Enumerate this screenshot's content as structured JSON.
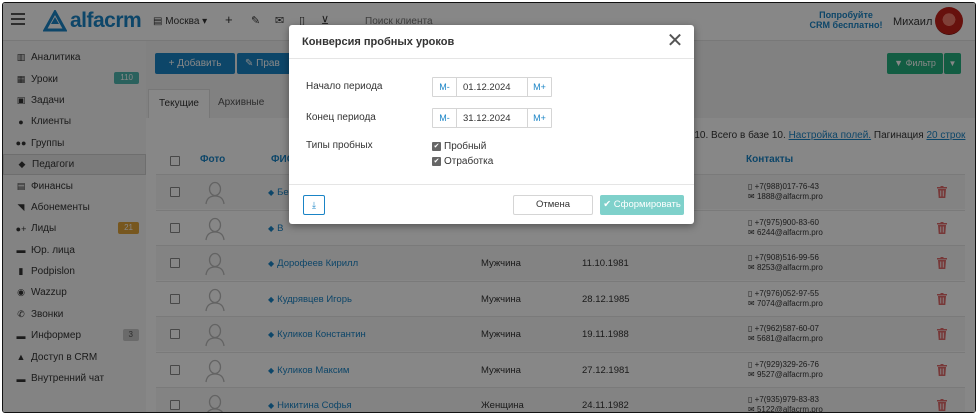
{
  "header": {
    "logo_text": "alfacrm",
    "branch": "Москва",
    "search_placeholder": "Поиск клиента",
    "promo_line1": "Попробуйте",
    "promo_line2": "CRM бесплатно!",
    "user_name": "Михаил"
  },
  "sidebar": {
    "items": [
      {
        "label": "Аналитика",
        "icon": "chart-icon"
      },
      {
        "label": "Уроки",
        "icon": "calendar-icon",
        "badge": "110",
        "badge_color": "#50b7b0"
      },
      {
        "label": "Задачи",
        "icon": "tasks-icon"
      },
      {
        "label": "Клиенты",
        "icon": "user-icon"
      },
      {
        "label": "Группы",
        "icon": "group-icon"
      },
      {
        "label": "Педагоги",
        "icon": "teacher-icon",
        "active": true
      },
      {
        "label": "Финансы",
        "icon": "money-icon"
      },
      {
        "label": "Абонементы",
        "icon": "tag-icon"
      },
      {
        "label": "Лиды",
        "icon": "lead-icon",
        "badge": "21",
        "badge_color": "#e0a43b"
      },
      {
        "label": "Юр. лица",
        "icon": "briefcase-icon"
      },
      {
        "label": "Podpislon",
        "icon": "doc-icon"
      },
      {
        "label": "Wazzup",
        "icon": "chat-icon"
      },
      {
        "label": "Звонки",
        "icon": "phone-icon"
      },
      {
        "label": "Информер",
        "icon": "informer-icon",
        "badge": "3",
        "badge_color": "#c9c9c9"
      },
      {
        "label": "Доступ в CRM",
        "icon": "lock-icon"
      },
      {
        "label": "Внутренний чат",
        "icon": "message-icon"
      }
    ]
  },
  "toolbar": {
    "add_label": "+ Добавить",
    "edit_label": "Прав",
    "filter_label": "Фильтр"
  },
  "tabs": [
    {
      "label": "Текущие",
      "active": true
    },
    {
      "label": "Архивные",
      "active": false
    }
  ],
  "pagination": {
    "text": "– 10. Всего в базе 10.",
    "settings_link": "Настройка полей.",
    "pagination_label": "Пагинация",
    "per_page_link": "20 строк"
  },
  "table": {
    "headers": {
      "photo": "Фото",
      "fio": "ФИО",
      "contacts": "Контакты"
    },
    "rows": [
      {
        "name": "Бе",
        "gender": "",
        "dob": "",
        "phone": "+7(988)017-76-43",
        "email": "1888@alfacrm.pro"
      },
      {
        "name": "В",
        "gender": "",
        "dob": "",
        "phone": "+7(975)900-83-60",
        "email": "6244@alfacrm.pro"
      },
      {
        "name": "Дорофеев Кирилл",
        "gender": "Мужчина",
        "dob": "11.10.1981",
        "phone": "+7(908)516-99-56",
        "email": "8253@alfacrm.pro"
      },
      {
        "name": "Кудрявцев Игорь",
        "gender": "Мужчина",
        "dob": "28.12.1985",
        "phone": "+7(976)052-97-55",
        "email": "7074@alfacrm.pro"
      },
      {
        "name": "Куликов Константин",
        "gender": "Мужчина",
        "dob": "19.11.1988",
        "phone": "+7(962)587-60-07",
        "email": "5681@alfacrm.pro"
      },
      {
        "name": "Куликов Максим",
        "gender": "Мужчина",
        "dob": "27.12.1981",
        "phone": "+7(929)329-26-76",
        "email": "9527@alfacrm.pro"
      },
      {
        "name": "Никитина Софья",
        "gender": "Женщина",
        "dob": "24.11.1982",
        "phone": "+7(935)979-83-83",
        "email": "5122@alfacrm.pro"
      }
    ]
  },
  "modal": {
    "title": "Конверсия пробных уроков",
    "start_label": "Начало периода",
    "start_date": "01.12.2024",
    "end_label": "Конец периода",
    "end_date": "31.12.2024",
    "minus_label": "M-",
    "plus_label": "M+",
    "types_label": "Типы пробных",
    "type_trial": "Пробный",
    "type_makeup": "Отработка",
    "cancel_label": "Отмена",
    "generate_label": "✔ Сформировать"
  }
}
